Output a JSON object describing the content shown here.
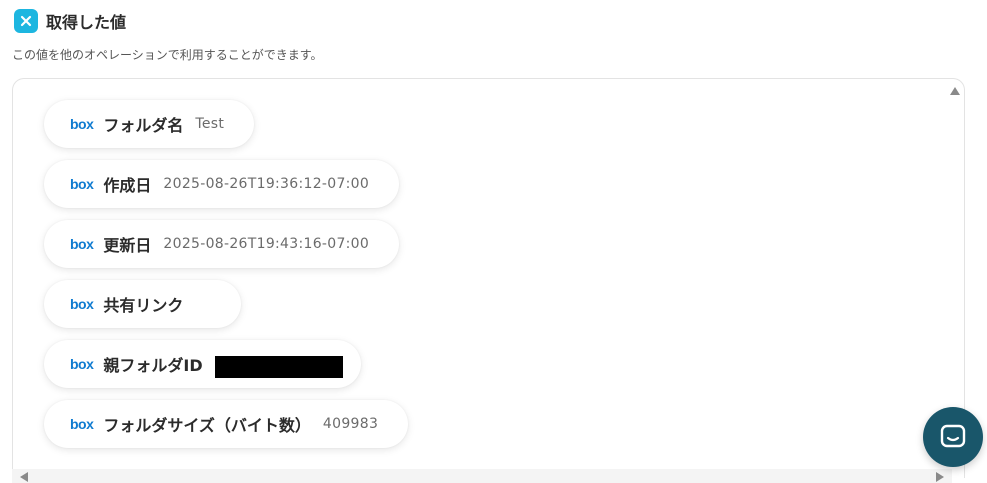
{
  "header": {
    "title": "取得した値",
    "description": "この値を他のオペレーションで利用することができます。"
  },
  "badge_icon": "yoom-x-icon",
  "service_logo_text": "box",
  "items": [
    {
      "label": "フォルダ名",
      "value": "Test"
    },
    {
      "label": "作成日",
      "value": "2025-08-26T19:36:12-07:00"
    },
    {
      "label": "更新日",
      "value": "2025-08-26T19:43:16-07:00"
    },
    {
      "label": "共有リンク",
      "value": ""
    },
    {
      "label": "親フォルダID",
      "value": ""
    },
    {
      "label": "フォルダサイズ（バイト数）",
      "value": "409983"
    }
  ],
  "colors": {
    "accent": "#1db6e0",
    "box_blue": "#0f7bd0",
    "chat": "#19566a"
  }
}
